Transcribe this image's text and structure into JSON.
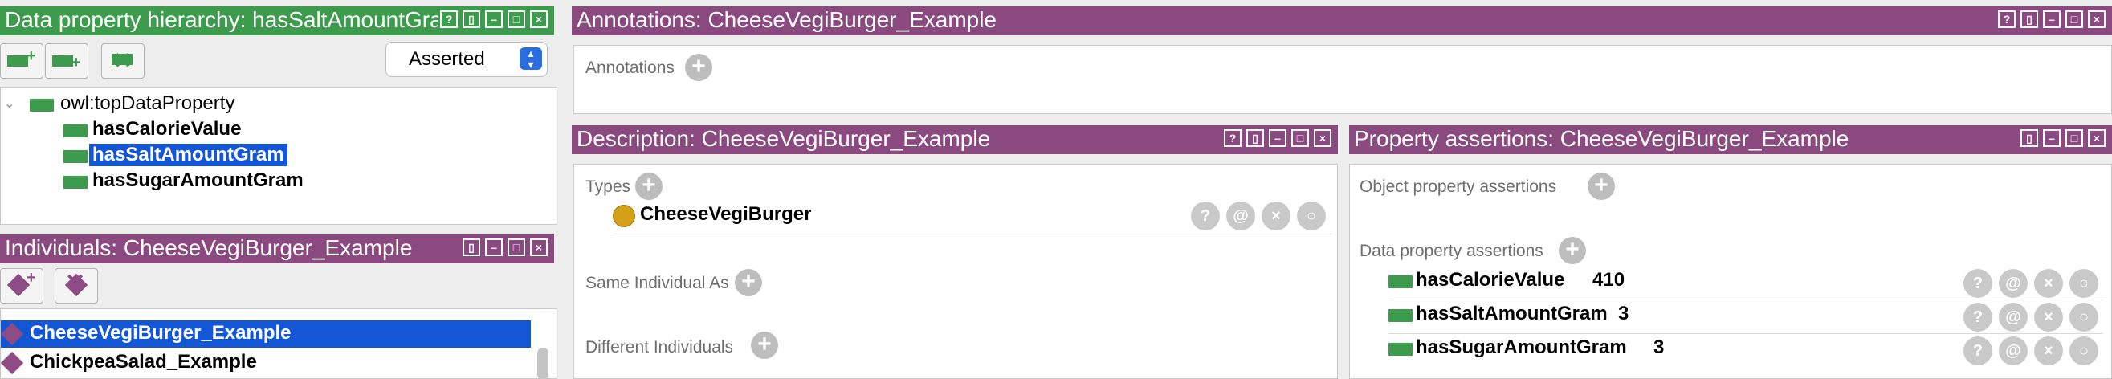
{
  "data_property_panel": {
    "title": "Data property hierarchy: hasSaltAmountGram",
    "mode_select": "Asserted",
    "root": "owl:topDataProperty",
    "items": [
      "hasCalorieValue",
      "hasSaltAmountGram",
      "hasSugarAmountGram"
    ],
    "selected": "hasSaltAmountGram"
  },
  "individuals_panel": {
    "title": "Individuals: CheeseVegiBurger_Example",
    "items": [
      "CheeseVegiBurger_Example",
      "ChickpeaSalad_Example"
    ]
  },
  "annotations_panel": {
    "title": "Annotations: CheeseVegiBurger_Example",
    "label": "Annotations"
  },
  "description_panel": {
    "title": "Description: CheeseVegiBurger_Example",
    "types_label": "Types",
    "type_value": "CheeseVegiBurger",
    "same_label": "Same Individual As",
    "different_label": "Different Individuals"
  },
  "property_panel": {
    "title": "Property assertions: CheeseVegiBurger_Example",
    "object_label": "Object property assertions",
    "data_label": "Data property assertions",
    "assertions": [
      {
        "property": "hasCalorieValue",
        "value": "410"
      },
      {
        "property": "hasSaltAmountGram",
        "value": "3"
      },
      {
        "property": "hasSugarAmountGram",
        "value": "3"
      }
    ]
  },
  "colors": {
    "green_header": "#3d9b4e",
    "purple_header": "#8a4a80",
    "selection": "#1457d6"
  }
}
